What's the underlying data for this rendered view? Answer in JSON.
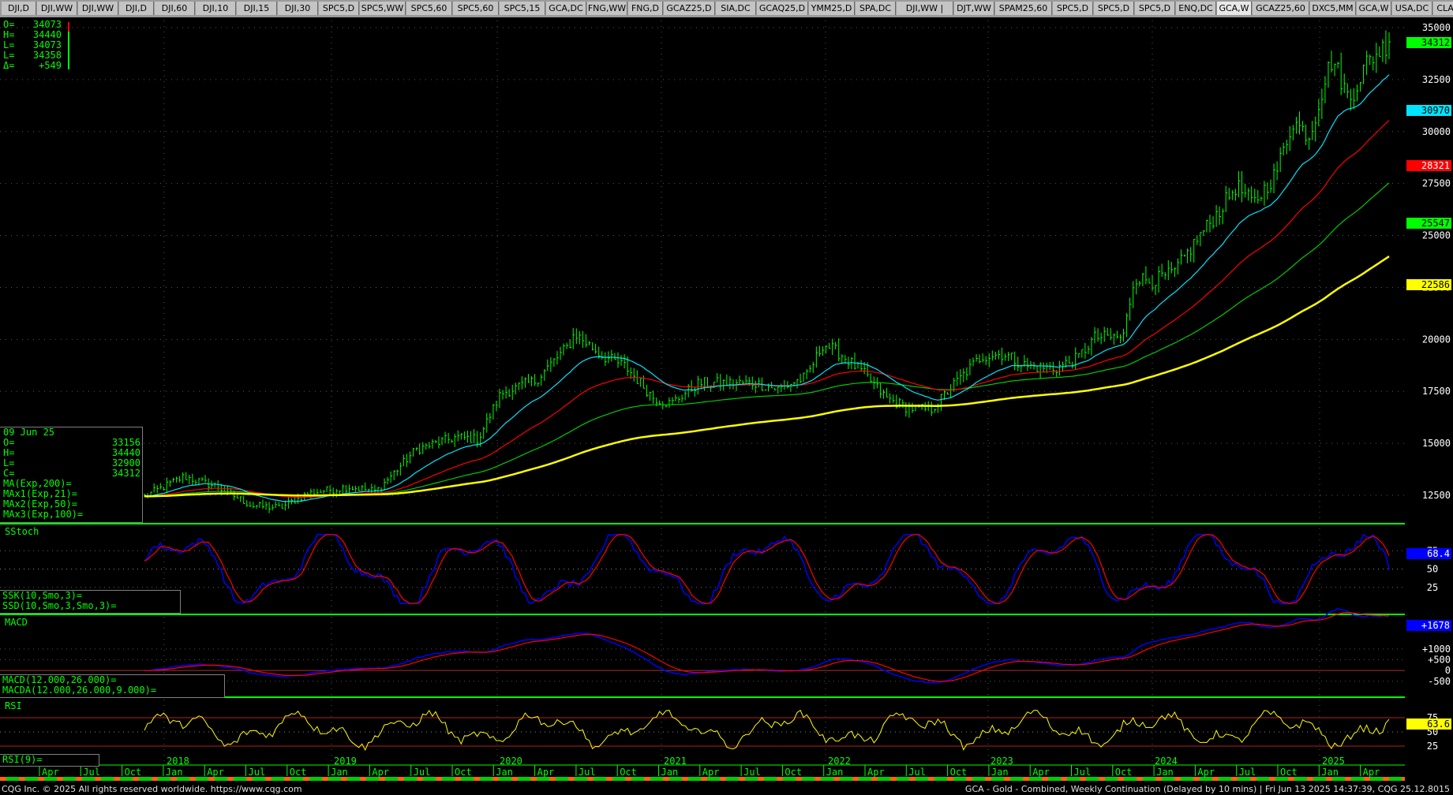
{
  "tabs": [
    "DJI,D",
    "DJI,WW",
    "DJI,WW",
    "DJI,D",
    "DJI,60",
    "DJI,10",
    "DJI,15",
    "DJI,30",
    "SPC5,D",
    "SPC5,WW",
    "SPC5,60",
    "SPC5,60",
    "SPC5,15",
    "GCA,DC",
    "FNG,WW",
    "FNG,D",
    "GCAZ25,D",
    "SIA,DC",
    "GCAQ25,D",
    "YMM25,D",
    "SPA,DC",
    "DJI,WW  |",
    "DJT,WW",
    "SPAM25,60",
    "SPC5,D",
    "SPC5,D",
    "SPC5,D",
    "ENQ,DC",
    "GCA,W",
    "GCAZ25,60",
    "DXC5,MM",
    "GCA,W",
    "USA,DC",
    "CLA,DC",
    "+"
  ],
  "active_tab_index": 28,
  "ohlc_top": {
    "labels": [
      "O=",
      "H=",
      "L=",
      "L=",
      "Δ="
    ],
    "values": [
      "34073",
      "34440",
      "34073",
      "34358",
      "+549"
    ]
  },
  "cursor_info": {
    "date": "09 Jun 25",
    "rows": [
      [
        "O=",
        "33156"
      ],
      [
        "H=",
        "34440"
      ],
      [
        "L=",
        "32900"
      ],
      [
        "C=",
        "34312"
      ],
      [
        "MA(Exp,200)=",
        ""
      ],
      [
        "MAx1(Exp,21)=",
        ""
      ],
      [
        "MAx2(Exp,50)=",
        ""
      ],
      [
        "MAx3(Exp,100)=",
        ""
      ]
    ]
  },
  "price_axis": {
    "ticks": [
      "35000",
      "32500",
      "30000",
      "27500",
      "25000",
      "22500",
      "20000",
      "17500",
      "15000",
      "12500"
    ]
  },
  "price_badges": [
    {
      "text": "34312",
      "bg": "#00ff00",
      "fg": "#000000"
    },
    {
      "text": "30970",
      "bg": "#00e5ff",
      "fg": "#000000"
    },
    {
      "text": "28321",
      "bg": "#ff0000",
      "fg": "#ffffff"
    },
    {
      "text": "25547",
      "bg": "#00ff00",
      "fg": "#000000"
    },
    {
      "text": "22586",
      "bg": "#ffff00",
      "fg": "#000000"
    }
  ],
  "sstoch": {
    "title": "SStoch",
    "legend": [
      "SSK(10,Smo,3)=",
      "SSD(10,Smo,3,Smo,3)="
    ],
    "ticks": [
      "75",
      "50",
      "25"
    ],
    "badge": "68.4",
    "badge_bg": "#0000ff",
    "badge_fg": "#ffffff"
  },
  "macd": {
    "title": "MACD",
    "legend": [
      "MACD(12.000,26.000)=",
      "MACDA(12.000,26.000,9.000)="
    ],
    "ticks": [
      "+1000",
      "+500",
      "0",
      "-500"
    ],
    "badge": "+1678",
    "badge_bg": "#0000ff",
    "badge_fg": "#ffffff"
  },
  "rsi": {
    "title": "RSI",
    "legend": [
      "RSI(9)="
    ],
    "ticks": [
      "75",
      "50",
      "25"
    ],
    "badge": "63.6",
    "badge_bg": "#ffff00",
    "badge_fg": "#000000"
  },
  "time_axis": {
    "months": [
      "Apr",
      "Jul",
      "Oct",
      "Jan",
      "Apr",
      "Jul",
      "Oct",
      "Jan",
      "Apr",
      "Jul",
      "Oct",
      "Jan",
      "Apr",
      "Jul",
      "Oct",
      "Jan",
      "Apr",
      "Jul",
      "Oct",
      "Jan",
      "Apr",
      "Jul",
      "Oct",
      "Jan",
      "Apr",
      "Jul",
      "Oct",
      "Jan",
      "Apr",
      "Jul",
      "Oct",
      "Jan",
      "Apr"
    ],
    "years": [
      "2018",
      "2019",
      "2020",
      "2021",
      "2022",
      "2023",
      "2024",
      "2025"
    ]
  },
  "colors": {
    "price": "#00ff00",
    "ma200": "#ffff00",
    "ma21": "#00e5ff",
    "ma50": "#ff0000",
    "ma100": "#00cc00",
    "stoch_k": "#0000ff",
    "stoch_d": "#ff0000",
    "macd": "#0000ff",
    "macda": "#ff0000",
    "rsi": "#ffff00",
    "grid": "#555555",
    "separator": "#00ff00"
  },
  "footer": {
    "left": "CQG Inc. © 2025 All rights reserved worldwide. https://www.cqg.com",
    "right": "GCA - Gold - Combined, Weekly Continuation (Delayed by 10 mins) | Fri Jun 13 2025 14:37:39, CQG 25.12.8015"
  }
}
